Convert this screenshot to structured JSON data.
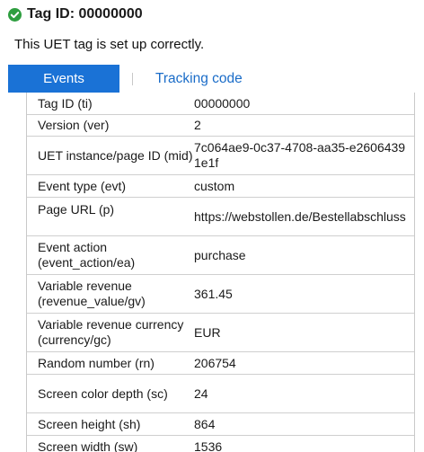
{
  "header": {
    "title": "Tag ID: 00000000",
    "status": "This UET tag is set up correctly."
  },
  "tabs": {
    "events_label": "Events",
    "tracking_label": "Tracking code"
  },
  "colors": {
    "accent": "#1a72d6",
    "success": "#2e9e3f",
    "link": "#1a6cc8"
  },
  "rows": [
    {
      "key": "Tag ID (ti)",
      "value": "00000000"
    },
    {
      "key": "Version (ver)",
      "value": "2"
    },
    {
      "key": "UET instance/page ID (mid)",
      "value": "7c064ae9-0c37-4708-aa35-e26064391e1f"
    },
    {
      "key": "Event type (evt)",
      "value": "custom"
    },
    {
      "key": "Page URL (p)",
      "value": "https://webstollen.de/Bestellabschluss"
    },
    {
      "key": "Event action (event_action/ea)",
      "value": "purchase"
    },
    {
      "key": "Variable revenue (revenue_value/gv)",
      "value": "361.45"
    },
    {
      "key": "Variable revenue currency (currency/gc)",
      "value": "EUR"
    },
    {
      "key": "Random number (rn)",
      "value": "206754"
    },
    {
      "key": "Screen color depth (sc)",
      "value": "24"
    },
    {
      "key": "Screen height (sh)",
      "value": "864"
    },
    {
      "key": "Screen width (sw)",
      "value": "1536"
    }
  ]
}
